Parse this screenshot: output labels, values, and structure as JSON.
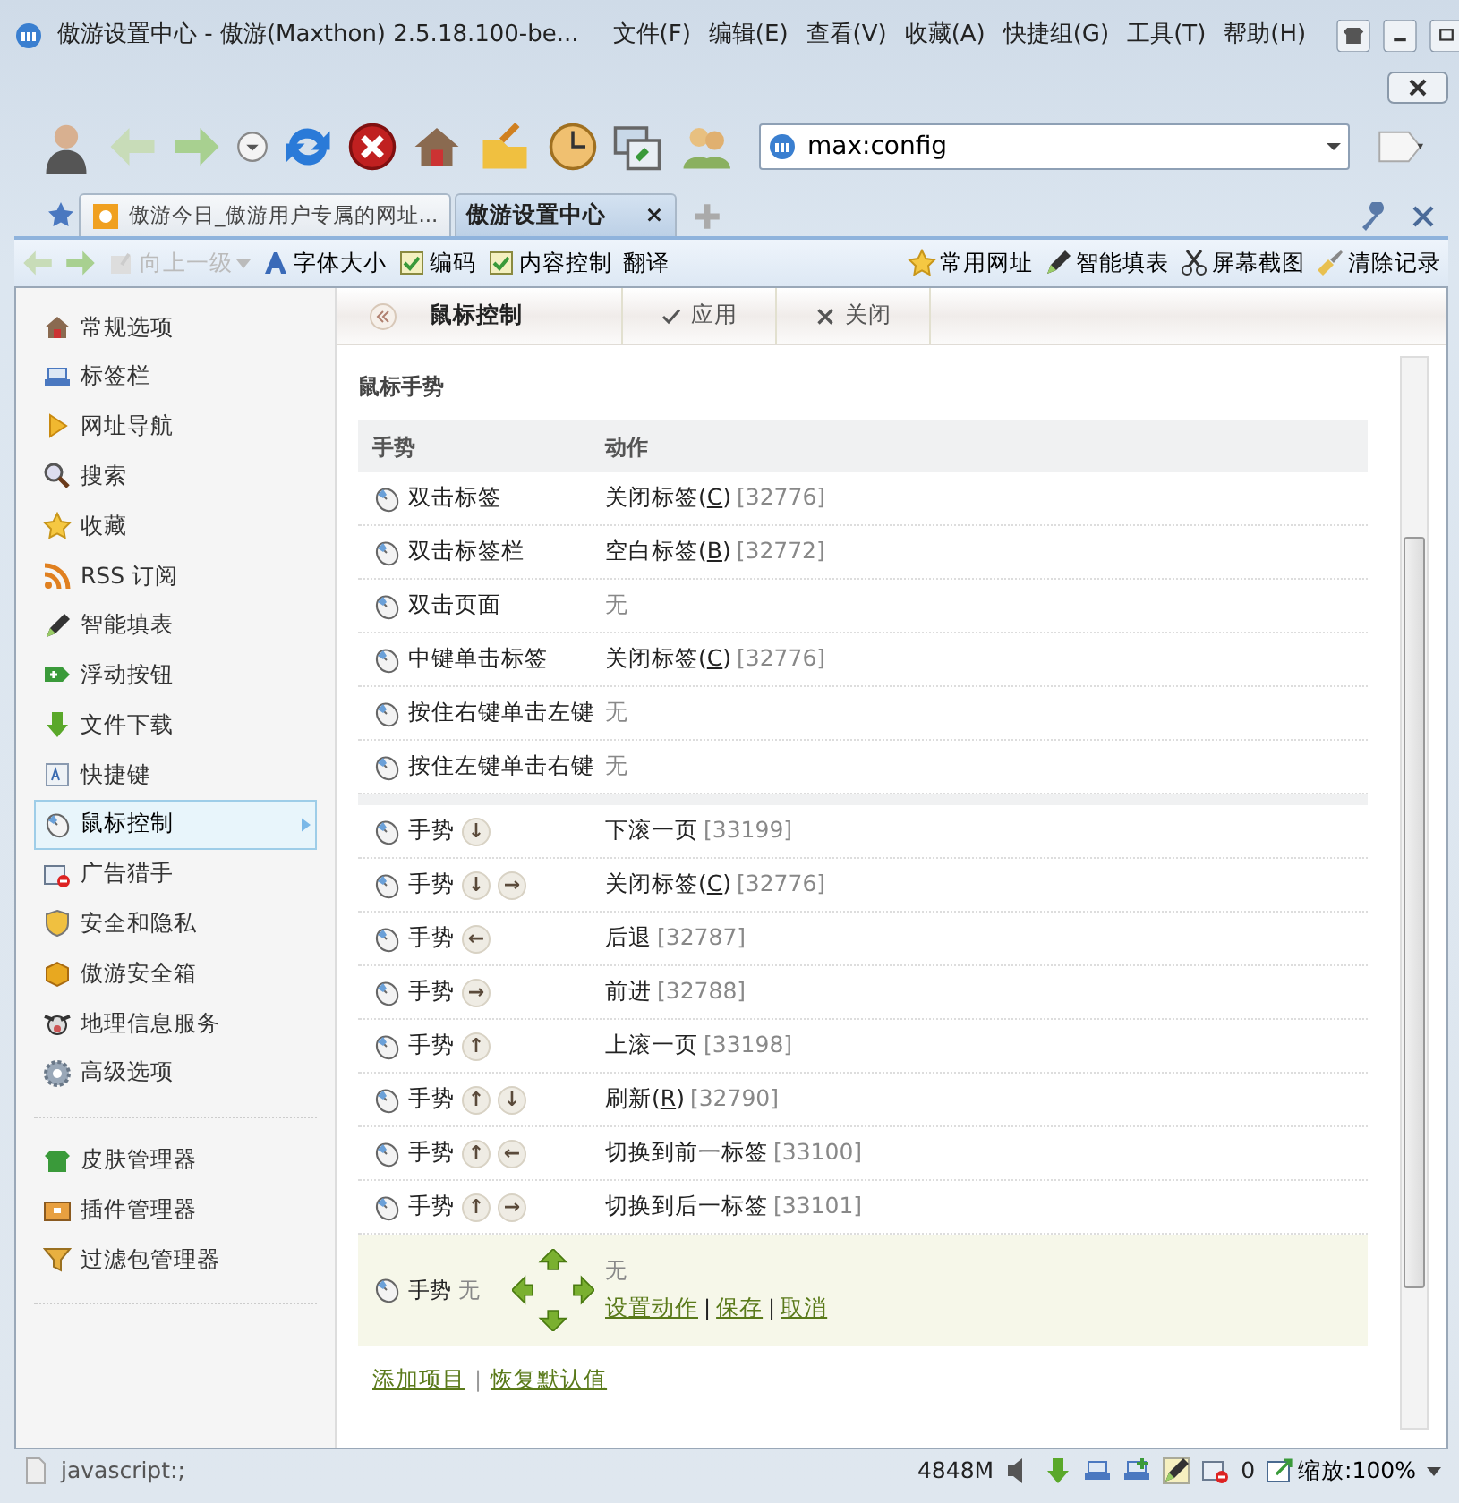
{
  "window": {
    "title": "傲游设置中心 - 傲游(Maxthon) 2.5.18.100-be..."
  },
  "menu": [
    "文件(F)",
    "编辑(E)",
    "查看(V)",
    "收藏(A)",
    "快捷组(G)",
    "工具(T)",
    "帮助(H)"
  ],
  "address": {
    "value": "max:config"
  },
  "tabs": [
    {
      "label": "傲游今日_傲游用户专属的网址...",
      "selected": false
    },
    {
      "label": "傲游设置中心",
      "selected": true
    }
  ],
  "tab_close": "×",
  "bar_left": [
    "向上一级",
    "字体大小",
    "编码",
    "内容控制",
    "翻译"
  ],
  "bar_right": [
    "常用网址",
    "智能填表",
    "屏幕截图",
    "清除记录"
  ],
  "sidebar": {
    "items": [
      {
        "label": "常规选项",
        "selected": false
      },
      {
        "label": "标签栏",
        "selected": false
      },
      {
        "label": "网址导航",
        "selected": false
      },
      {
        "label": "搜索",
        "selected": false
      },
      {
        "label": "收藏",
        "selected": false
      },
      {
        "label": "RSS 订阅",
        "selected": false
      },
      {
        "label": "智能填表",
        "selected": false
      },
      {
        "label": "浮动按钮",
        "selected": false
      },
      {
        "label": "文件下载",
        "selected": false
      },
      {
        "label": "快捷键",
        "selected": false
      },
      {
        "label": "鼠标控制",
        "selected": true
      },
      {
        "label": "广告猎手",
        "selected": false
      },
      {
        "label": "安全和隐私",
        "selected": false
      },
      {
        "label": "傲游安全箱",
        "selected": false
      },
      {
        "label": "地理信息服务",
        "selected": false
      },
      {
        "label": "高级选项",
        "selected": false
      }
    ],
    "extras": [
      "皮肤管理器",
      "插件管理器",
      "过滤包管理器"
    ]
  },
  "page_toolbar": {
    "title": "鼠标控制",
    "buttons": [
      "应用",
      "关闭"
    ]
  },
  "section": "鼠标手势",
  "table": {
    "columns": [
      "手势",
      "动作"
    ],
    "clicks": [
      {
        "gesture": "双击标签",
        "action_pre": "关闭标签(",
        "accel": "C",
        "action_post": ")",
        "code": "[32776]"
      },
      {
        "gesture": "双击标签栏",
        "action_pre": "空白标签(",
        "accel": "B",
        "action_post": ")",
        "code": "[32772]"
      },
      {
        "gesture": "双击页面",
        "none": "无"
      },
      {
        "gesture": "中键单击标签",
        "action_pre": "关闭标签(",
        "accel": "C",
        "action_post": ")",
        "code": "[32776]"
      },
      {
        "gesture": "按住右键单击左键",
        "none": "无"
      },
      {
        "gesture": "按住左键单击右键",
        "none": "无"
      }
    ],
    "gestures": [
      {
        "gesture": "手势",
        "strokes": [
          "↓"
        ],
        "action": "下滚一页",
        "code": "[33199]"
      },
      {
        "gesture": "手势",
        "strokes": [
          "↓",
          "→"
        ],
        "action_pre": "关闭标签(",
        "accel": "C",
        "action_post": ")",
        "code": "[32776]"
      },
      {
        "gesture": "手势",
        "strokes": [
          "←"
        ],
        "action": "后退",
        "code": "[32787]"
      },
      {
        "gesture": "手势",
        "strokes": [
          "→"
        ],
        "action": "前进",
        "code": "[32788]"
      },
      {
        "gesture": "手势",
        "strokes": [
          "↑"
        ],
        "action": "上滚一页",
        "code": "[33198]"
      },
      {
        "gesture": "手势",
        "strokes": [
          "↑",
          "↓"
        ],
        "action_pre": "刷新(",
        "accel": "R",
        "action_post": ")",
        "code": "[32790]"
      },
      {
        "gesture": "手势",
        "strokes": [
          "↑",
          "←"
        ],
        "action": "切换到前一标签",
        "code": "[33100]"
      },
      {
        "gesture": "手势",
        "strokes": [
          "↑",
          "→"
        ],
        "action": "切换到后一标签",
        "code": "[33101]"
      }
    ],
    "editor": {
      "gesture": "手势",
      "value": "无",
      "action": "无",
      "links": [
        "设置动作",
        "保存",
        "取消"
      ],
      "separator": "|"
    }
  },
  "footer_links": [
    "添加项目",
    "恢复默认值"
  ],
  "footer_separator": "|",
  "status": {
    "url": "javascript:;",
    "memory": "4848M",
    "blocked": "0",
    "zoom": "缩放:100%"
  }
}
